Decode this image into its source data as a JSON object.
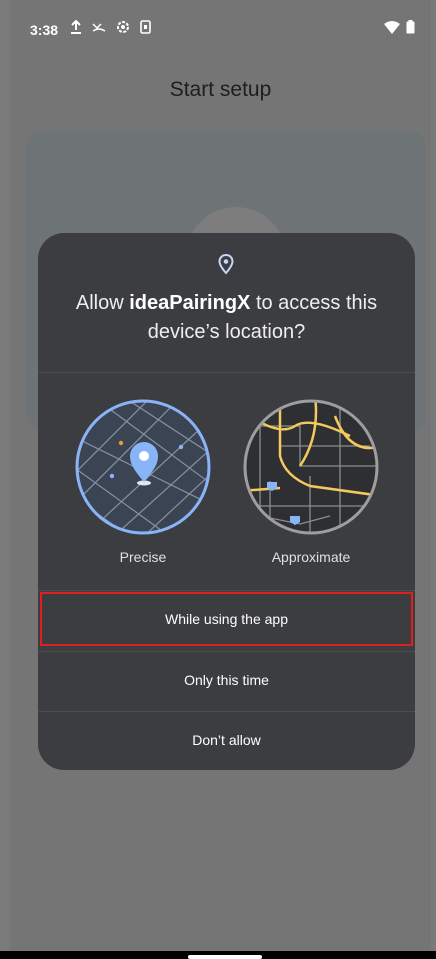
{
  "status_bar": {
    "time": "3:38",
    "icons_left": [
      "upload-icon",
      "missed-call-icon",
      "settings-icon",
      "sim-icon"
    ],
    "icons_right": [
      "wifi-icon",
      "battery-icon"
    ]
  },
  "page": {
    "title": "Start setup"
  },
  "dialog": {
    "icon": "location-pin-icon",
    "title_prefix": "Allow ",
    "app_name": "ideaPairingX",
    "title_suffix": " to access this device’s location?",
    "options": [
      {
        "label": "Precise",
        "icon": "precise-map-icon"
      },
      {
        "label": "Approximate",
        "icon": "approximate-map-icon"
      }
    ],
    "buttons": {
      "while_using": "While using the app",
      "only_this_time": "Only this time",
      "dont_allow": "Don’t allow"
    },
    "highlight_color": "#e02020"
  },
  "colors": {
    "dialog_bg": "#3c3d40",
    "accent_blue": "#8ab4f8",
    "map_road_yellow": "#f4c95d"
  }
}
